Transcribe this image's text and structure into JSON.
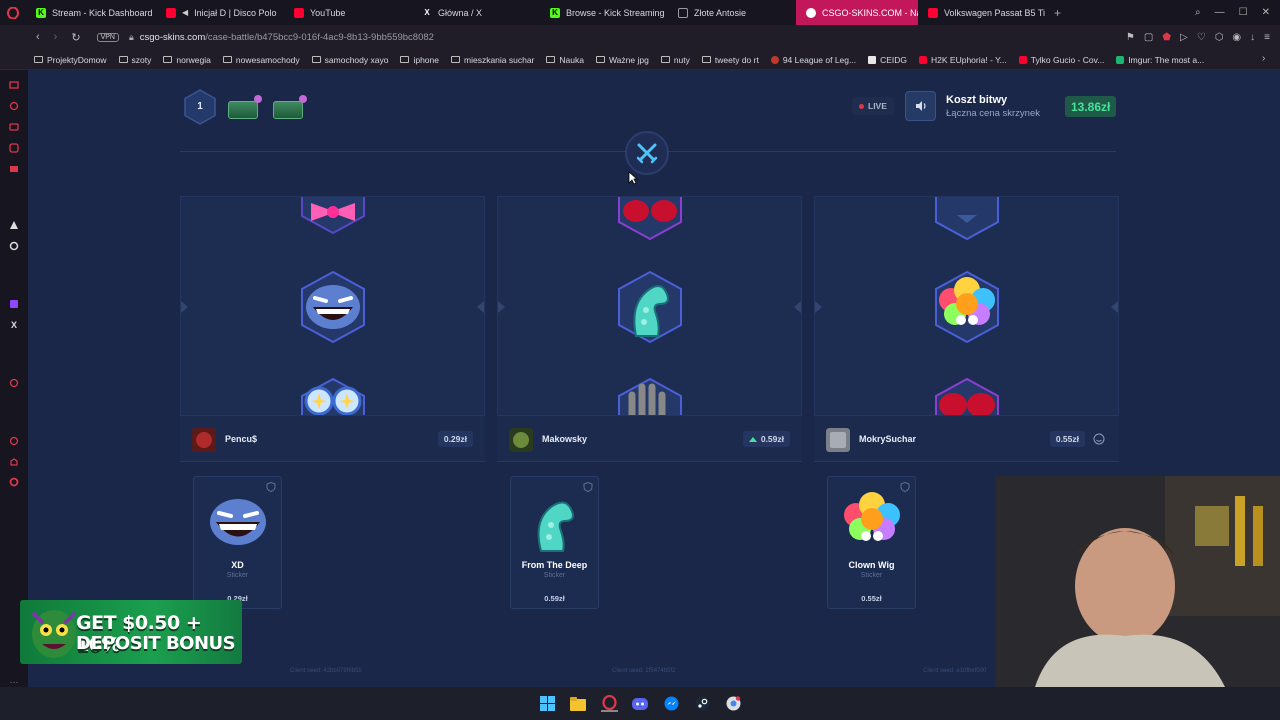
{
  "tabs": [
    {
      "title": "Stream - Kick Dashboard",
      "icon": "kick-icon",
      "color": "#53fc18"
    },
    {
      "title": "Inicjał D | Disco Polo",
      "icon": "youtube-icon",
      "color": "#ff0033"
    },
    {
      "title": "YouTube",
      "icon": "youtube-icon",
      "color": "#ff0033"
    },
    {
      "title": "Główna / X",
      "icon": "x-icon",
      "color": "#ffffff"
    },
    {
      "title": "Browse - Kick Streaming",
      "icon": "kick-icon",
      "color": "#53fc18"
    },
    {
      "title": "Złote Antosie",
      "icon": "page-icon",
      "color": "#999999"
    },
    {
      "title": "CSGO-SKINS.COM - Naj",
      "icon": "site-icon",
      "color": "#ffffff",
      "active": true
    },
    {
      "title": "Volkswagen Passat B5 Ti",
      "icon": "youtube-icon",
      "color": "#ff0033"
    }
  ],
  "address": {
    "vpn_label": "VPN",
    "host": "csgo-skins.com",
    "path": "/case-battle/b475bcc9-016f-4ac9-8b13-9bb559bc8082"
  },
  "bookmarks": [
    {
      "label": "ProjektyDomow",
      "type": "folder"
    },
    {
      "label": "szoty",
      "type": "folder"
    },
    {
      "label": "norwegia",
      "type": "folder"
    },
    {
      "label": "nowesamochody",
      "type": "folder"
    },
    {
      "label": "samochody xayo",
      "type": "folder"
    },
    {
      "label": "iphone",
      "type": "folder"
    },
    {
      "label": "mieszkania suchar",
      "type": "folder"
    },
    {
      "label": "Nauka",
      "type": "folder"
    },
    {
      "label": "Ważne jpg",
      "type": "folder"
    },
    {
      "label": "nuty",
      "type": "folder"
    },
    {
      "label": "tweety do rt",
      "type": "folder"
    },
    {
      "label": "94 League of Leg...",
      "type": "site",
      "color": "#c0392b"
    },
    {
      "label": "CEIDG",
      "type": "site",
      "color": "#e8e8e8"
    },
    {
      "label": "H2K EUphoria! - Y...",
      "type": "site",
      "color": "#ff0033"
    },
    {
      "label": "Tylko Gucio - Cov...",
      "type": "site",
      "color": "#ff0033"
    },
    {
      "label": "Imgur: The most a...",
      "type": "site",
      "color": "#1bb76e"
    }
  ],
  "battle": {
    "round": "1",
    "live_label": "LIVE",
    "cost_title": "Koszt bitwy",
    "cost_subtitle": "Łączna cena skrzynek",
    "cost_value": "13.86zł"
  },
  "players": [
    {
      "name": "Pencu$",
      "value": "0.29zł",
      "seed": "Client seed: 42bb079f6b5b",
      "item": {
        "name": "XD",
        "type": "Sticker",
        "price": "0.29zł"
      }
    },
    {
      "name": "Makowsky",
      "value": "0.59zł",
      "leading": true,
      "seed": "Client seed: 2f5474b5f2",
      "item": {
        "name": "From The Deep",
        "type": "Sticker",
        "price": "0.59zł"
      }
    },
    {
      "name": "MokrySuchar",
      "value": "0.55zł",
      "seed": "Client seed: e10fbef000",
      "item": {
        "name": "Clown Wig",
        "type": "Sticker",
        "price": "0.55zł"
      }
    }
  ],
  "promo": {
    "line1": "GET $0.50 + 10%",
    "line2": "DEPOSIT BONUS"
  },
  "colors": {
    "accent_green": "#45e29a",
    "page_bg": "#1a2748",
    "active_tab": "#c2185b"
  }
}
